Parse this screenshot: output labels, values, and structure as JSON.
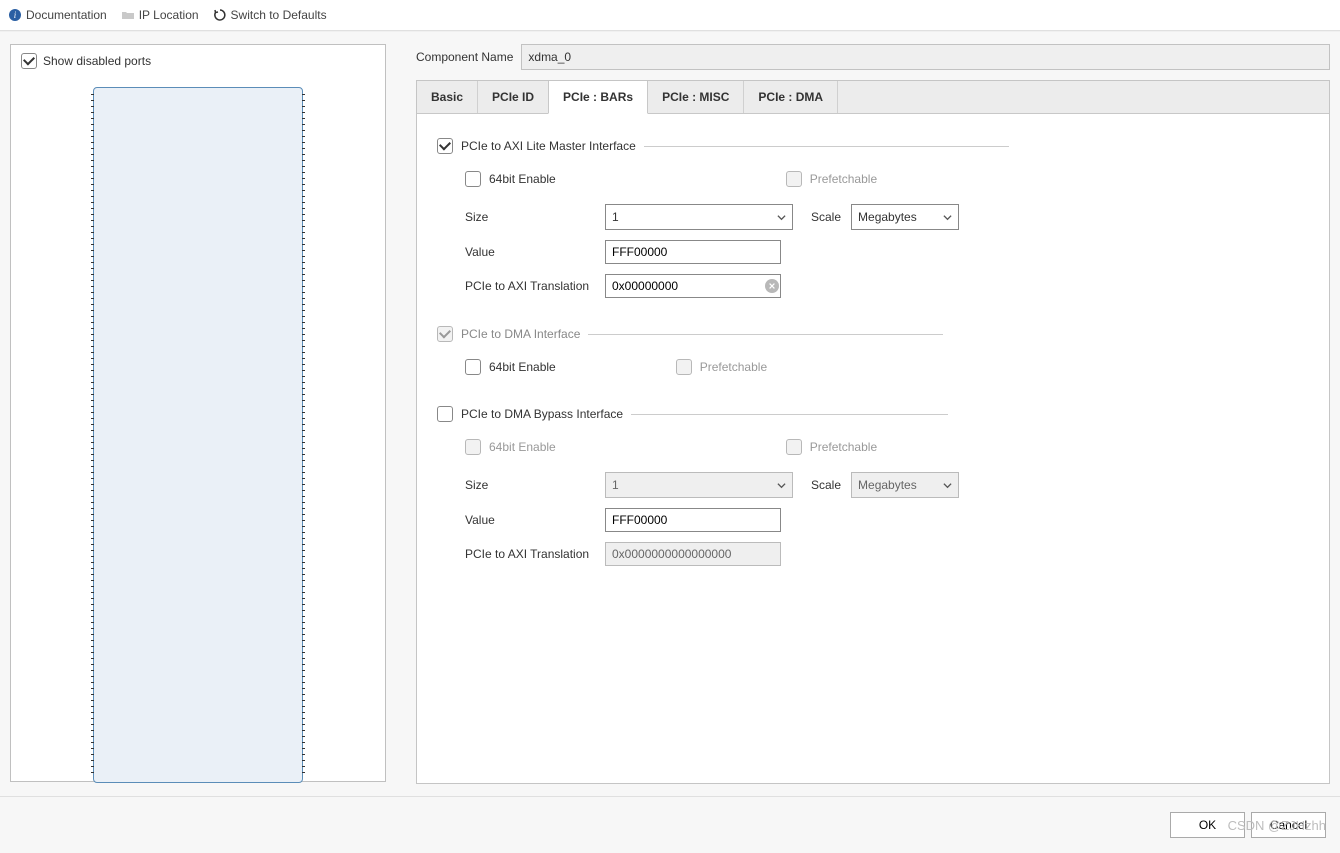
{
  "toolbar": {
    "documentation": "Documentation",
    "ip_location": "IP Location",
    "switch_defaults": "Switch to Defaults"
  },
  "left": {
    "show_disabled_ports": "Show disabled ports"
  },
  "component_name": {
    "label": "Component Name",
    "value": "xdma_0"
  },
  "tabs": {
    "basic": "Basic",
    "pcie_id": "PCIe ID",
    "pcie_bars": "PCIe : BARs",
    "pcie_misc": "PCIe : MISC",
    "pcie_dma": "PCIe : DMA"
  },
  "group1": {
    "title": "PCIe to AXI Lite Master Interface",
    "enable64": "64bit Enable",
    "prefetchable": "Prefetchable",
    "size_label": "Size",
    "size_value": "1",
    "scale_label": "Scale",
    "scale_value": "Megabytes",
    "value_label": "Value",
    "value_text": "FFF00000",
    "translation_label": "PCIe to AXI Translation",
    "translation_value": "0x00000000"
  },
  "group2": {
    "title": "PCIe to DMA Interface",
    "enable64": "64bit Enable",
    "prefetchable": "Prefetchable"
  },
  "group3": {
    "title": "PCIe to DMA Bypass Interface",
    "enable64": "64bit Enable",
    "prefetchable": "Prefetchable",
    "size_label": "Size",
    "size_value": "1",
    "scale_label": "Scale",
    "scale_value": "Megabytes",
    "value_label": "Value",
    "value_text": "FFF00000",
    "translation_label": "PCIe to AXI Translation",
    "translation_value": "0x0000000000000000"
  },
  "footer": {
    "ok": "OK",
    "cancel": "Cancel"
  },
  "watermark": "CSDN @ZJHzhh"
}
